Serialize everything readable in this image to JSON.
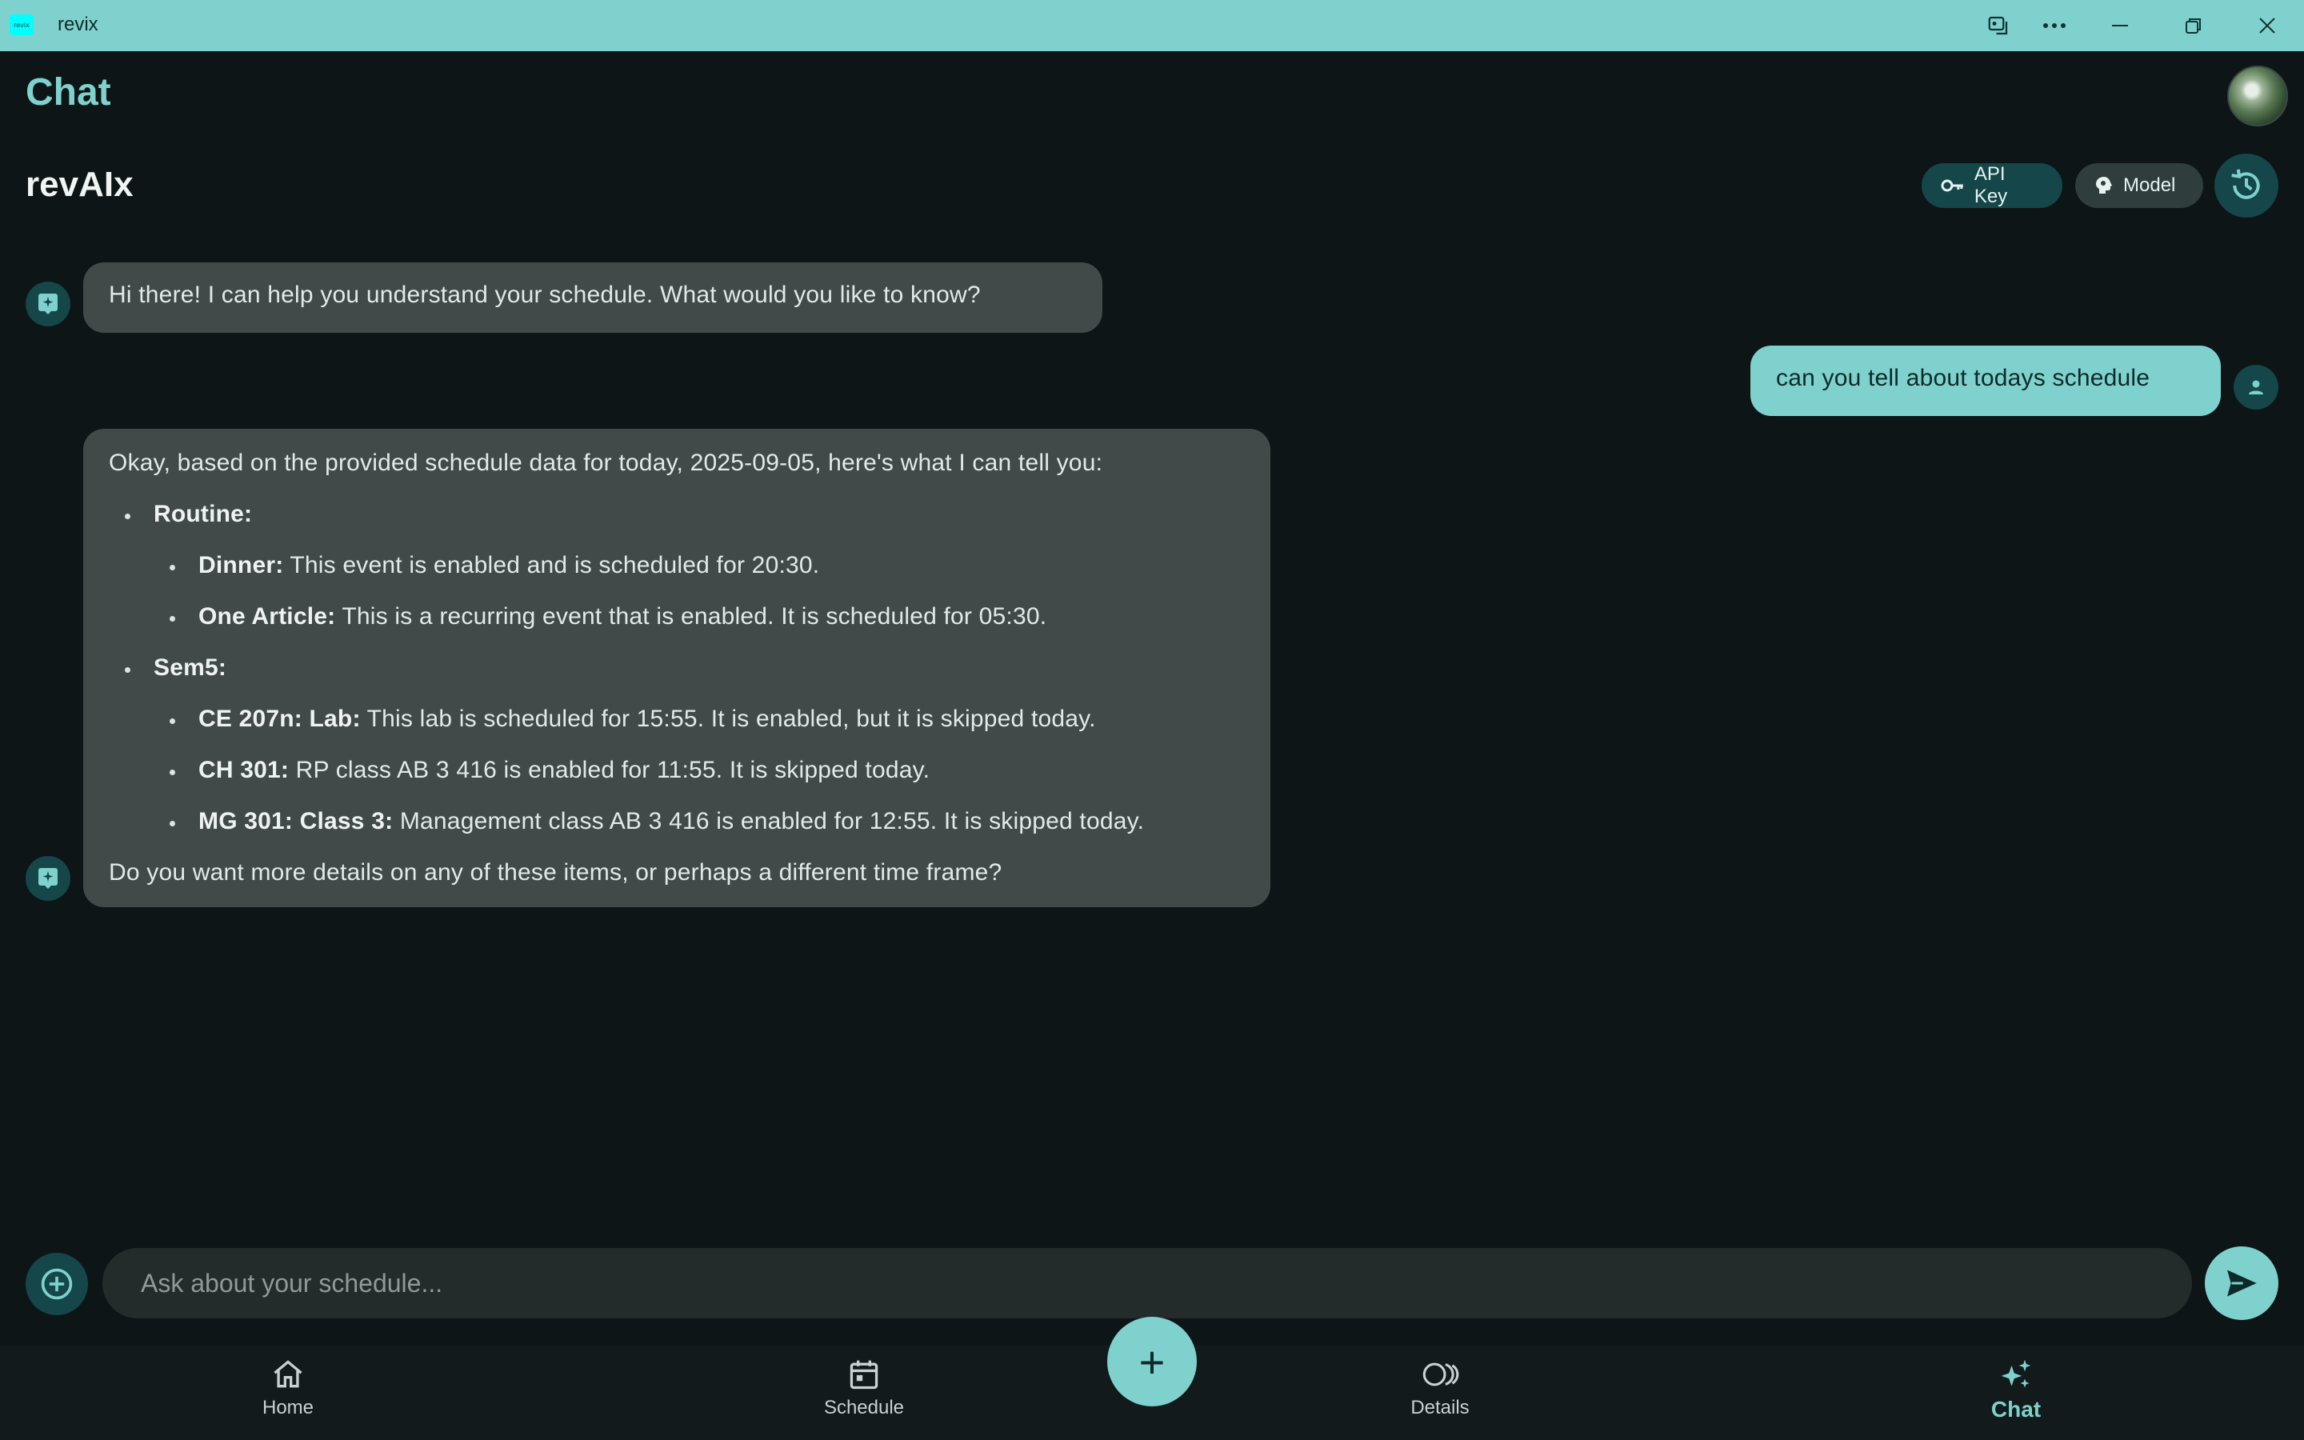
{
  "window": {
    "app_name": "revix",
    "logo_text": "revix"
  },
  "header": {
    "title": "Chat",
    "subtitle": "revAIx"
  },
  "toolbar": {
    "api_key_label": "API Key",
    "model_label": "Model"
  },
  "messages": {
    "bot_greeting": "Hi there! I can help you understand your schedule. What would you like to know?",
    "user_query": "can you tell about todays schedule",
    "bot_reply": {
      "intro": "Okay, based on the provided schedule data for today, 2025-09-05, here's what I can tell you:",
      "routine_heading": "Routine:",
      "dinner_label": "Dinner:",
      "dinner_text": " This event is enabled and is scheduled for 20:30.",
      "article_label": "One Article:",
      "article_text": " This is a recurring event that is enabled. It is scheduled for 05:30.",
      "sem_heading": "Sem5:",
      "ce_label": "CE 207n: Lab:",
      "ce_text": " This lab is scheduled for 15:55. It is enabled, but it is skipped today.",
      "ch_label": "CH 301:",
      "ch_text": " RP class AB 3 416 is enabled for 11:55. It is skipped today.",
      "mg_label": "MG 301: Class 3:",
      "mg_text": " Management class AB 3 416 is enabled for 12:55. It is skipped today.",
      "outro": "Do you want more details on any of these items, or perhaps a different time frame?"
    }
  },
  "composer": {
    "placeholder": "Ask about your schedule..."
  },
  "nav": {
    "home": "Home",
    "schedule": "Schedule",
    "details": "Details",
    "chat": "Chat",
    "fab": "+"
  },
  "colors": {
    "accent": "#7fd1cd",
    "background": "#0e1516",
    "bubble_bot": "#414949"
  }
}
